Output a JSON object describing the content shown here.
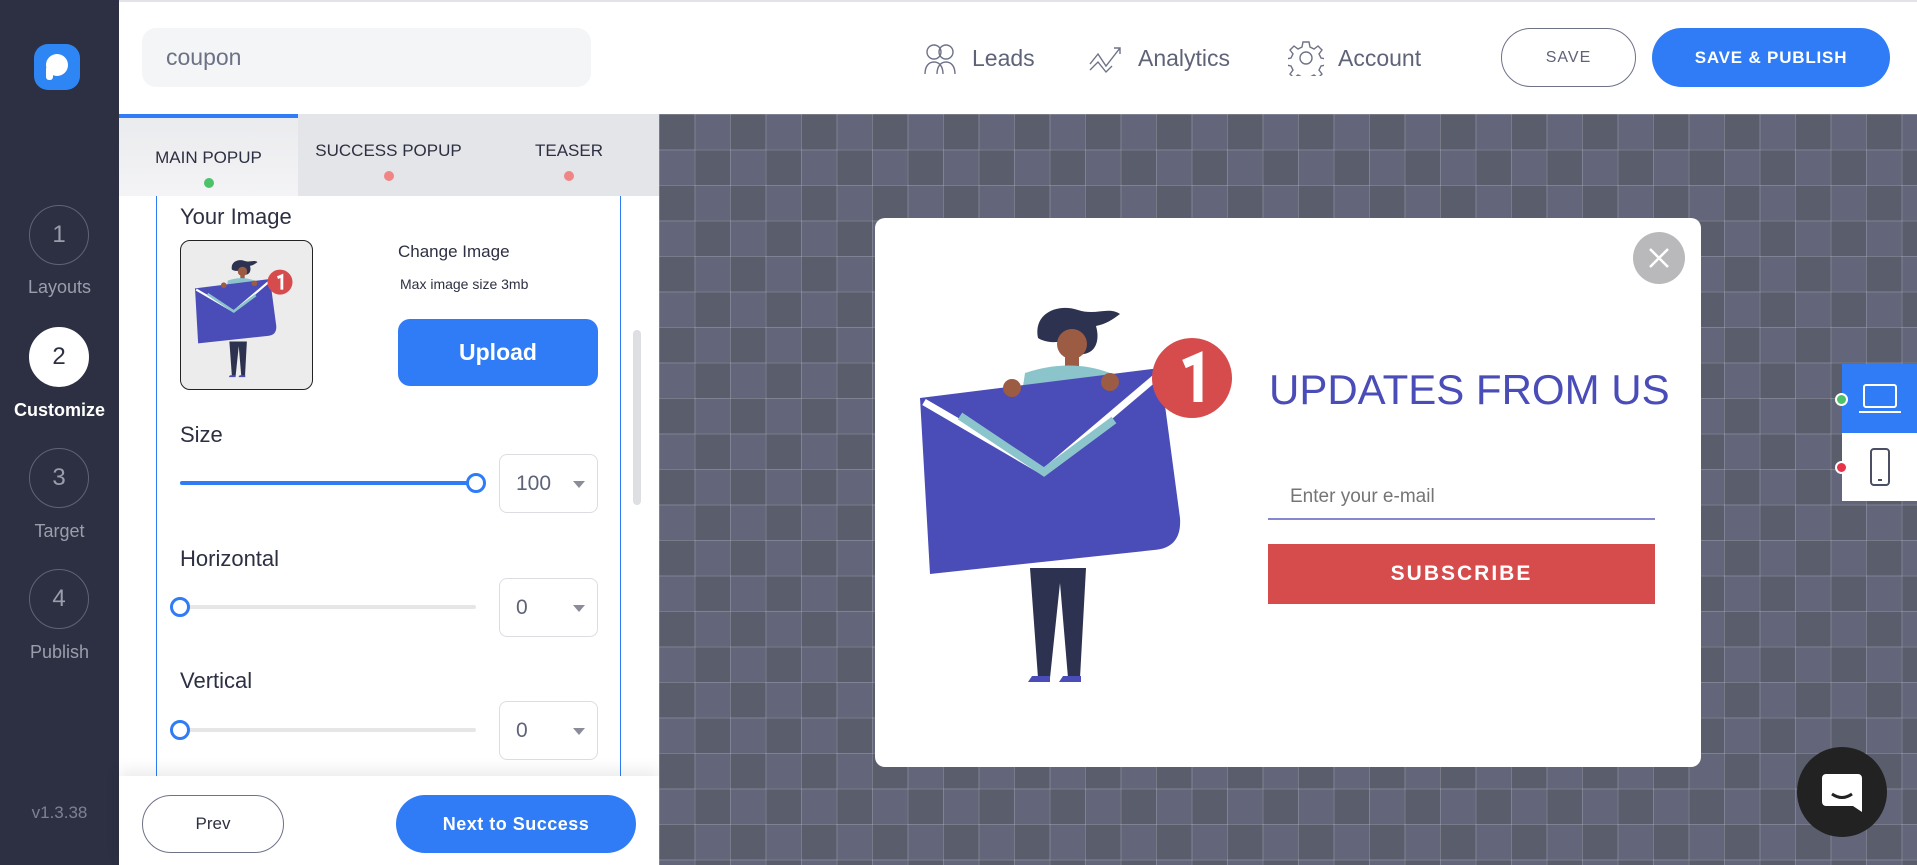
{
  "app": {
    "version": "v1.3.38"
  },
  "steps": [
    {
      "num": "1",
      "label": "Layouts"
    },
    {
      "num": "2",
      "label": "Customize"
    },
    {
      "num": "3",
      "label": "Target"
    },
    {
      "num": "4",
      "label": "Publish"
    }
  ],
  "header": {
    "campaign_name": "coupon",
    "nav": [
      {
        "label": "Leads",
        "icon": "leads-icon"
      },
      {
        "label": "Analytics",
        "icon": "analytics-icon"
      },
      {
        "label": "Account",
        "icon": "gear-icon"
      }
    ],
    "save_label": "SAVE",
    "publish_label": "SAVE & PUBLISH"
  },
  "tabs": [
    {
      "label": "MAIN POPUP",
      "status": "#4cc26a"
    },
    {
      "label": "SUCCESS POPUP",
      "status": "#f08585"
    },
    {
      "label": "TEASER",
      "status": "#f08585"
    }
  ],
  "editor": {
    "image_heading": "Your Image",
    "change_image": "Change Image",
    "max_size": "Max image size 3mb",
    "upload_label": "Upload",
    "size": {
      "label": "Size",
      "value": "100",
      "slider_percent": 100
    },
    "horizontal": {
      "label": "Horizontal",
      "value": "0",
      "slider_percent": 0
    },
    "vertical": {
      "label": "Vertical",
      "value": "0",
      "slider_percent": 0
    }
  },
  "footer": {
    "prev_label": "Prev",
    "next_label": "Next to Success"
  },
  "popup": {
    "title": "UPDATES FROM US",
    "email_placeholder": "Enter your e-mail",
    "subscribe_label": "SUBSCRIBE",
    "badge": "1",
    "colors": {
      "title": "#4a4cb8",
      "button": "#d64c4c"
    }
  },
  "device_toggle": {
    "desktop_status": "#4cc26a",
    "mobile_status": "#e8334a",
    "active": "desktop"
  },
  "colors": {
    "accent": "#2f7cf6",
    "sidebar": "#2d3042"
  }
}
